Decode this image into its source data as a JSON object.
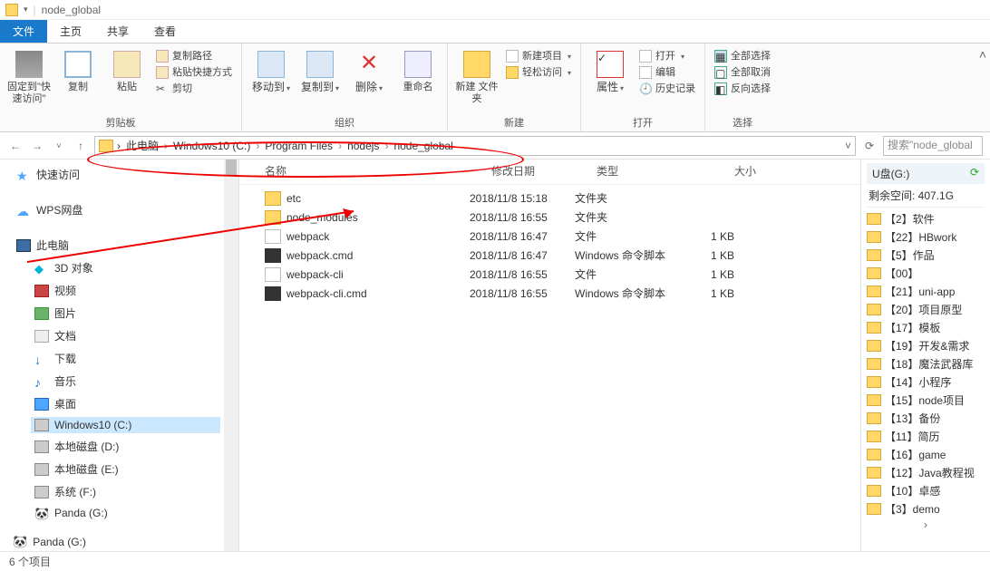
{
  "title_path": "node_global",
  "tabs": {
    "file": "文件",
    "home": "主页",
    "share": "共享",
    "view": "查看"
  },
  "ribbon": {
    "clipboard": {
      "name": "剪贴板",
      "pin": "固定到\"快\n速访问\"",
      "copy": "复制",
      "paste": "粘贴",
      "copypath": "复制路径",
      "pasteshort": "粘贴快捷方式",
      "cut": "剪切"
    },
    "organize": {
      "name": "组织",
      "moveto": "移动到",
      "copyto": "复制到",
      "delete": "删除",
      "rename": "重命名"
    },
    "new": {
      "name": "新建",
      "newfolder": "新建\n文件夹",
      "newitem": "新建项目",
      "easyaccess": "轻松访问"
    },
    "open": {
      "name": "打开",
      "props": "属性",
      "open": "打开",
      "edit": "编辑",
      "history": "历史记录"
    },
    "select": {
      "name": "选择",
      "selectall": "全部选择",
      "selectnone": "全部取消",
      "invert": "反向选择"
    }
  },
  "breadcrumb": [
    "此电脑",
    "Windows10 (C:)",
    "Program Files",
    "nodejs",
    "node_global"
  ],
  "search_placeholder": "搜索\"node_global",
  "columns": {
    "name": "名称",
    "date": "修改日期",
    "type": "类型",
    "size": "大小"
  },
  "files": [
    {
      "icon": "folder",
      "name": "etc",
      "date": "2018/11/8 15:18",
      "type": "文件夹",
      "size": ""
    },
    {
      "icon": "folder",
      "name": "node_modules",
      "date": "2018/11/8 16:55",
      "type": "文件夹",
      "size": ""
    },
    {
      "icon": "file",
      "name": "webpack",
      "date": "2018/11/8 16:47",
      "type": "文件",
      "size": "1 KB"
    },
    {
      "icon": "cmd",
      "name": "webpack.cmd",
      "date": "2018/11/8 16:47",
      "type": "Windows 命令脚本",
      "size": "1 KB"
    },
    {
      "icon": "file",
      "name": "webpack-cli",
      "date": "2018/11/8 16:55",
      "type": "文件",
      "size": "1 KB"
    },
    {
      "icon": "cmd",
      "name": "webpack-cli.cmd",
      "date": "2018/11/8 16:55",
      "type": "Windows 命令脚本",
      "size": "1 KB"
    }
  ],
  "nav": {
    "quick": "快速访问",
    "wps": "WPS网盘",
    "thispc": "此电脑",
    "3d": "3D 对象",
    "video": "视频",
    "pics": "图片",
    "docs": "文档",
    "down": "下载",
    "music": "音乐",
    "desk": "桌面",
    "cdrive": "Windows10 (C:)",
    "ddrive": "本地磁盘 (D:)",
    "edrive": "本地磁盘 (E:)",
    "fdrive": "系统 (F:)",
    "gdrive": "Panda (G:)",
    "panda": "Panda (G:)"
  },
  "preview": {
    "drive": "U盘(G:)",
    "space": "剩余空间: 407.1G",
    "items": [
      "【2】软件",
      "【22】HBwork",
      "【5】作品",
      "【00】",
      "【21】uni-app",
      "【20】项目原型",
      "【17】模板",
      "【19】开发&需求",
      "【18】魔法武器库",
      "【14】小程序",
      "【15】node项目",
      "【13】备份",
      "【11】简历",
      "【16】game",
      "【12】Java教程视",
      "【10】卓感",
      "【3】demo"
    ]
  },
  "status": "6 个项目"
}
